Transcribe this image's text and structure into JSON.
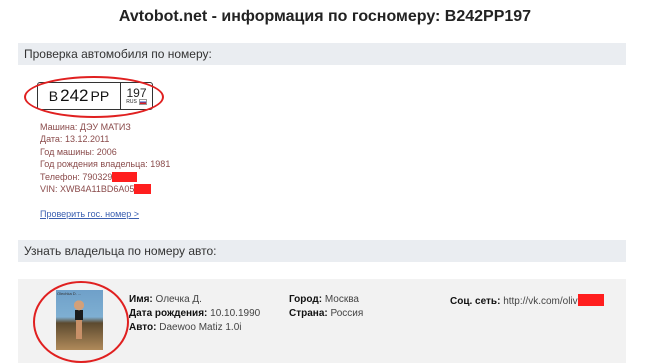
{
  "page": {
    "title": "Avtobot.net - информация по госномеру: В242РР197"
  },
  "check_section": {
    "title": "Проверка автомобиля по номеру:"
  },
  "plate": {
    "letter1": "В",
    "digits": "242",
    "letters2": "РР",
    "region": "197",
    "country": "RUS"
  },
  "details": [
    {
      "label": "Машина:",
      "value": "ДЭУ МАТИЗ"
    },
    {
      "label": "Дата:",
      "value": "13.12.2011"
    },
    {
      "label": "Год машины:",
      "value": "2006"
    },
    {
      "label": "Год рождения владельца:",
      "value": "1981"
    },
    {
      "label": "Телефон:",
      "value": "790329"
    },
    {
      "label": "VIN:",
      "value": "XWB4A11BD6A05"
    }
  ],
  "check_link": "Проверить гос. номер >",
  "owner_section": {
    "title": "Узнать владельца по номеру авто:"
  },
  "owner": {
    "photo_caption": "Olechka D. ...",
    "name_label": "Имя:",
    "name_value": "Олечка Д.",
    "dob_label": "Дата рождения:",
    "dob_value": "10.10.1990",
    "car_label": "Авто:",
    "car_value": "Daewoo Matiz 1.0i",
    "city_label": "Город:",
    "city_value": "Москва",
    "country_label": "Страна:",
    "country_value": "Россия",
    "social_label": "Соц. сеть:",
    "social_value": "http://vk.com/oliv"
  },
  "colors": {
    "highlight": "#e02020",
    "redaction": "#ff1e1e",
    "section_bg": "#eaedf1",
    "link": "#3a5fb0"
  }
}
